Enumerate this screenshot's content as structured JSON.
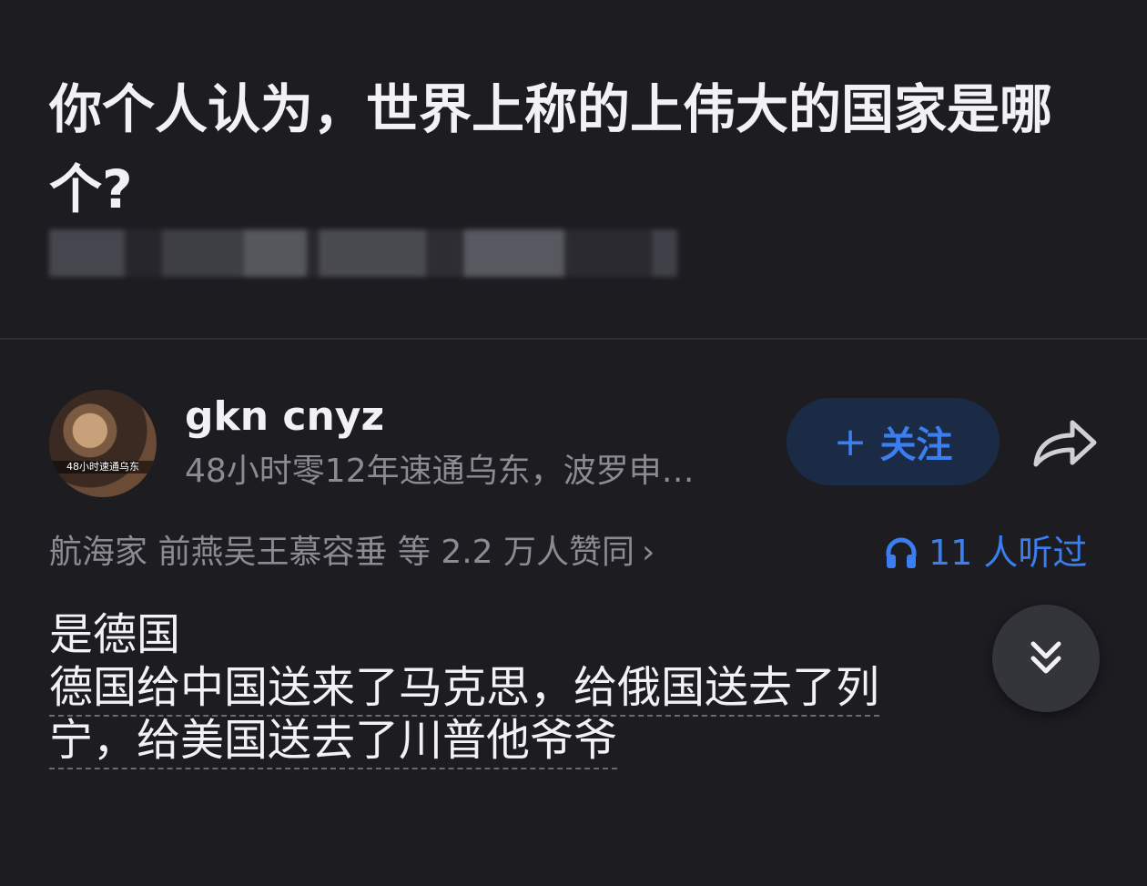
{
  "question": {
    "title": "你个人认为，世界上称的上伟大的国家是哪个?"
  },
  "author": {
    "name": "gkn cnyz",
    "bio": "48小时零12年速通乌东，波罗申…",
    "avatar_caption": "48小时速通乌东",
    "follow_label": "关注",
    "follow_icon": "plus-icon"
  },
  "upvotes": {
    "text": "航海家 前燕吴王慕容垂 等 2.2 万人赞同",
    "chevron": "›"
  },
  "listened": {
    "text": "11 人听过",
    "icon": "headphone-icon"
  },
  "answer": {
    "line1": "是德国",
    "line2": "德国给中国送来了马克思，给俄国送去了列",
    "line3": "宁，给美国送去了川普他爷爷"
  },
  "colors": {
    "background": "#1c1c21",
    "accent": "#3b7ef0",
    "follow_bg": "#1b2a45",
    "muted_text": "#8b8b92"
  }
}
